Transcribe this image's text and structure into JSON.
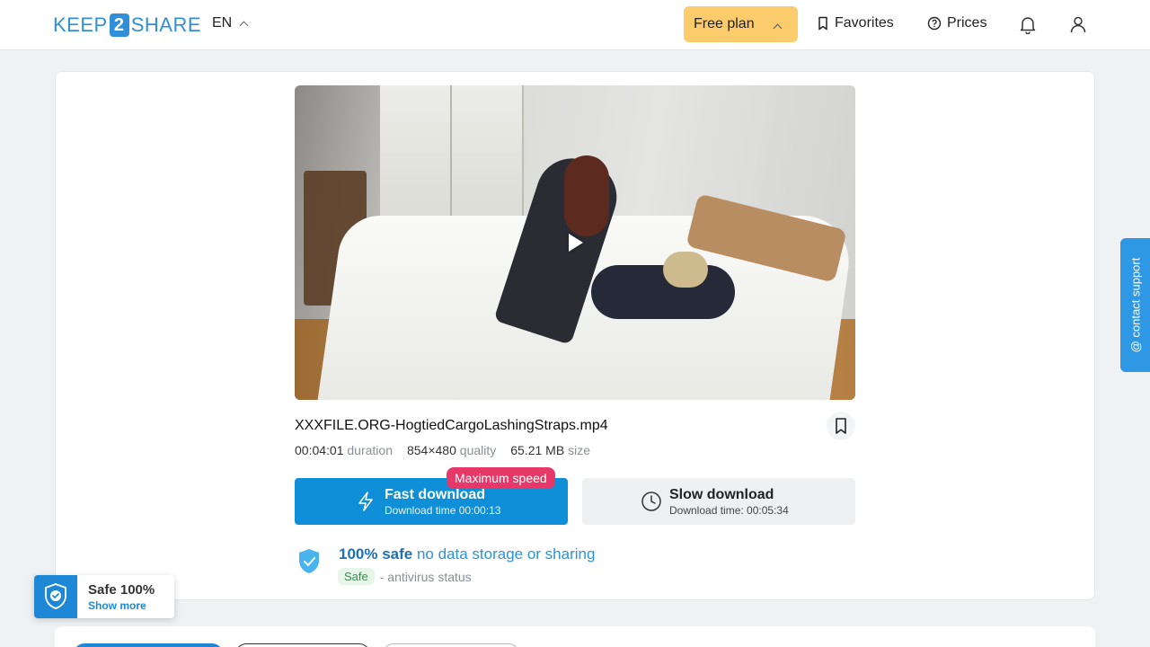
{
  "header": {
    "logo_left": "KEEP",
    "logo_mid": "2",
    "logo_right": "SHARE",
    "language": "EN",
    "plan_label": "Free plan",
    "favorites_label": "Favorites",
    "prices_label": "Prices"
  },
  "file": {
    "name": "XXXFILE.ORG-HogtiedCargoLashingStraps.mp4",
    "duration_value": "00:04:01",
    "duration_label": "duration",
    "quality_value": "854×480",
    "quality_label": "quality",
    "size_value": "65.21 MB",
    "size_label": "size"
  },
  "downloads": {
    "fast_title": "Fast download",
    "fast_sub": "Download time 00:00:13",
    "badge": "Maximum speed",
    "slow_title": "Slow download",
    "slow_sub": "Download time: 00:05:34"
  },
  "safety": {
    "strong": "100% safe",
    "rest": " no data storage or sharing",
    "chip": "Safe",
    "status_text": "- antivirus status"
  },
  "support": {
    "label": "@ contact support"
  },
  "safe_widget": {
    "title": "Safe 100%",
    "link": "Show more"
  },
  "colors": {
    "accent": "#0e8fd8",
    "plan": "#fccb6b",
    "badge": "#e63869",
    "safe_chip_bg": "#e6f7ea"
  }
}
